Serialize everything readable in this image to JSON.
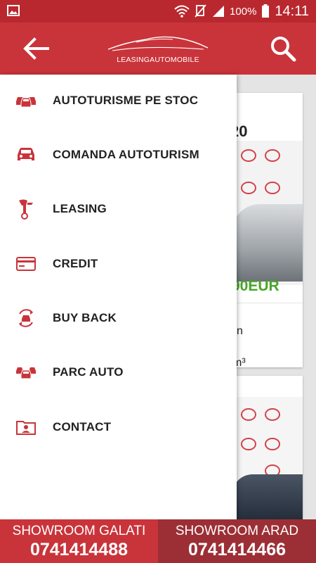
{
  "status_bar": {
    "battery_percent": "100%",
    "time": "14:11",
    "icons": [
      "image-icon",
      "wifi-icon",
      "mute-icon",
      "signal-icon",
      "battery-icon"
    ]
  },
  "app_bar": {
    "logo_text": "LEASINGAUTOMOBILE",
    "back_icon": "arrow-back-icon",
    "search_icon": "search-icon"
  },
  "drawer": {
    "items": [
      {
        "label": "AUTOTURISME PE STOC",
        "icon": "cars-icon"
      },
      {
        "label": "COMANDA AUTOTURISM",
        "icon": "car-front-icon"
      },
      {
        "label": "LEASING",
        "icon": "key-icon"
      },
      {
        "label": "CREDIT",
        "icon": "credit-card-icon"
      },
      {
        "label": "BUY BACK",
        "icon": "car-cycle-icon"
      },
      {
        "label": "PARC AUTO",
        "icon": "car-fleet-icon"
      },
      {
        "label": "CONTACT",
        "icon": "contact-folder-icon"
      }
    ]
  },
  "background_cards": {
    "card1_title_fragment": "20",
    "card1_price_fragment": "90EUR",
    "card1_line1_fragment": "n",
    "card1_line2_fragment": "m³"
  },
  "showrooms": [
    {
      "name": "SHOWROOM GALATI",
      "phone": "0741414488"
    },
    {
      "name": "SHOWROOM ARAD",
      "phone": "0741414466"
    }
  ],
  "colors": {
    "primary": "#c9343a",
    "status_bar": "#b9282e",
    "secondary": "#9c2f35",
    "price": "#4aa42a"
  }
}
